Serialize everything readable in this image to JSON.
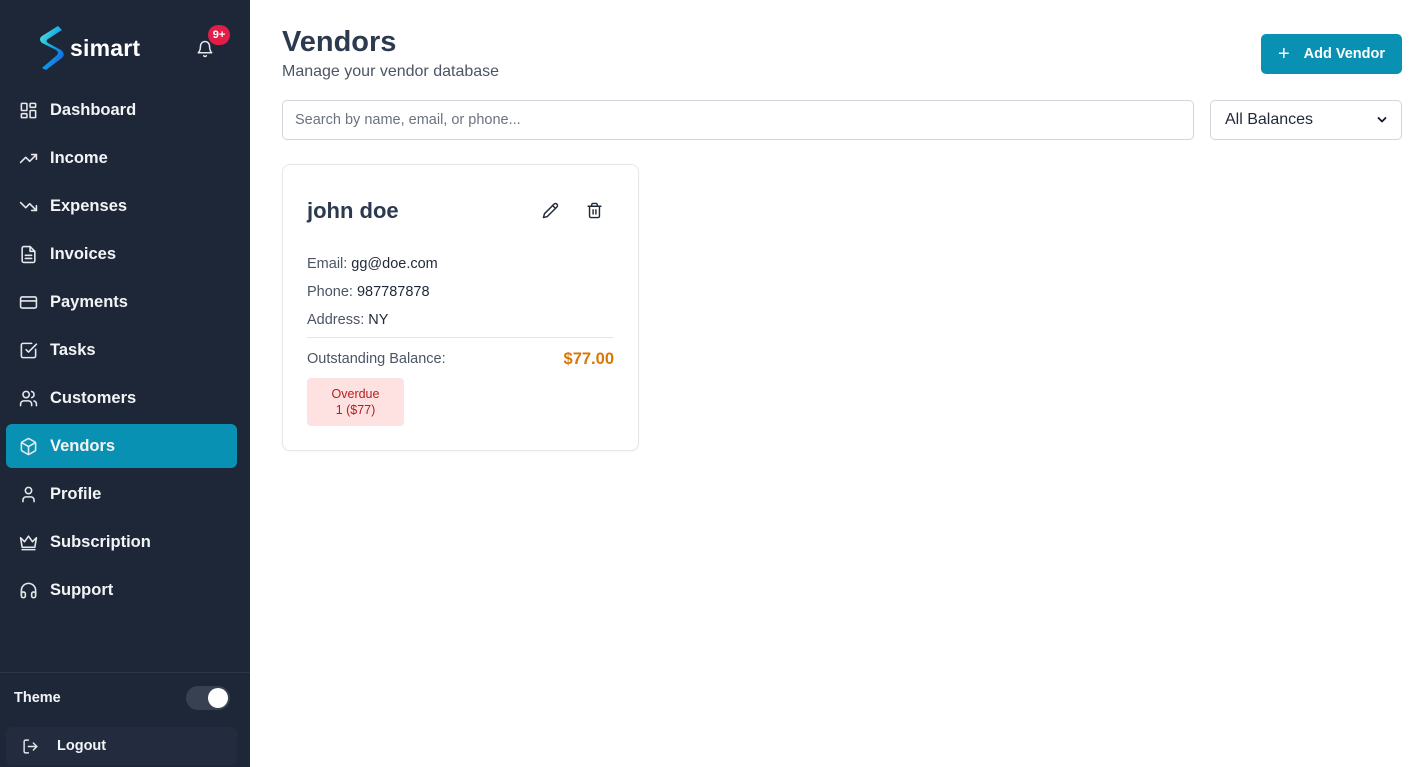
{
  "brand": {
    "name": "simart",
    "notification_badge": "9+"
  },
  "sidebar": {
    "items": [
      {
        "label": "Dashboard",
        "icon": "dashboard-icon",
        "active": false
      },
      {
        "label": "Income",
        "icon": "trending-up-icon",
        "active": false
      },
      {
        "label": "Expenses",
        "icon": "trending-down-icon",
        "active": false
      },
      {
        "label": "Invoices",
        "icon": "document-icon",
        "active": false
      },
      {
        "label": "Payments",
        "icon": "credit-card-icon",
        "active": false
      },
      {
        "label": "Tasks",
        "icon": "checkbox-icon",
        "active": false
      },
      {
        "label": "Customers",
        "icon": "users-icon",
        "active": false
      },
      {
        "label": "Vendors",
        "icon": "box-icon",
        "active": true
      },
      {
        "label": "Profile",
        "icon": "user-icon",
        "active": false
      },
      {
        "label": "Subscription",
        "icon": "crown-icon",
        "active": false
      },
      {
        "label": "Support",
        "icon": "headphones-icon",
        "active": false
      }
    ],
    "theme_label": "Theme",
    "theme_toggle_on": true,
    "logout_label": "Logout"
  },
  "header": {
    "title": "Vendors",
    "subtitle": "Manage your vendor database",
    "add_button_label": "Add Vendor"
  },
  "search": {
    "placeholder": "Search by name, email, or phone...",
    "value": ""
  },
  "filter": {
    "selected": "All Balances"
  },
  "vendors": [
    {
      "name": "john doe",
      "email_label": "Email:",
      "email": "gg@doe.com",
      "phone_label": "Phone:",
      "phone": "987787878",
      "address_label": "Address:",
      "address": "NY",
      "balance_label": "Outstanding Balance:",
      "balance": "$77.00",
      "overdue_label": "Overdue",
      "overdue_detail": "1 ($77)"
    }
  ],
  "colors": {
    "sidebar_bg": "#1e2738",
    "accent": "#0891b2",
    "badge": "#e11d48",
    "balance": "#d97706",
    "overdue_bg": "#fee2e2",
    "overdue_text": "#b91c1c"
  }
}
